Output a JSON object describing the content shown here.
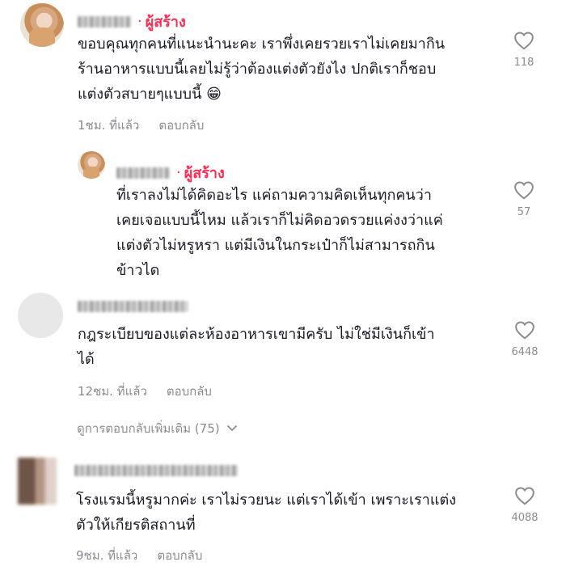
{
  "comments": [
    {
      "badge": "ผู้สร้าง",
      "text_lines": [
        "ขอบคุณทุกคนที่แนะนำนะคะ เราพึ่งเคยรวยเราไม่เคยมากิน",
        "ร้านอาหารแบบนี้เลยไม่รู้ว่าต้องแต่งตัวยังไง ปกติเราก็ชอบ",
        "แต่งตัวสบายๆแบบนี้ 😁"
      ],
      "time": "1ชม. ที่แล้ว",
      "reply_label": "ตอบกลับ",
      "likes": "118"
    },
    {
      "badge": "ผู้สร้าง",
      "text_lines": [
        "ที่เราลงไม่ได้คิดอะไร แค่ถามความคิดเห็นทุกคนว่า",
        "เคยเจอแบบนี้ไหม แล้วเราก็ไม่คิดอวดรวยแค่งงว่าแค่",
        "แต่งตัวไม่หรูหรา แต่มีเงินในกระเป๋าก็ไม่สามารถกิน",
        "ข้าวได"
      ],
      "likes": "57"
    },
    {
      "text_lines": [
        "กฎระเบียบของแต่ละห้องอาหารเขามีครับ ไม่ใช่มีเงินก็เข้า",
        "ได้"
      ],
      "time": "12ชม. ที่แล้ว",
      "reply_label": "ตอบกลับ",
      "likes": "6448"
    },
    {
      "text_lines": [
        "โรงแรมนี้หรูมากค่ะ เราไม่รวยนะ แต่เราได้เข้า เพราะเราแต่ง",
        "ตัวให้เกียรติสถานที่"
      ],
      "time": "9ชม. ที่แล้ว",
      "reply_label": "ตอบกลับ",
      "likes": "4088"
    }
  ],
  "more_replies": "ดูการตอบกลับเพิ่มเติม (75)",
  "colors": {
    "creator": "#fe2c55",
    "meta": "#8a8b91",
    "text": "#161823"
  }
}
